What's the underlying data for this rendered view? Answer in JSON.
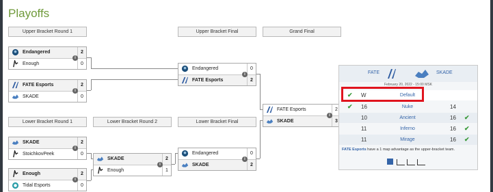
{
  "page_title": "Playoffs",
  "headers": {
    "ubr1": "Upper Bracket Round 1",
    "ubf": "Upper Bracket Final",
    "gf": "Grand Final",
    "lbr1": "Lower Bracket Round 1",
    "lbr2": "Lower Bracket Round 2",
    "lbf": "Lower Bracket Final"
  },
  "matches": {
    "ub1": {
      "t1": "Endangered",
      "s1": "2",
      "t2": "Enough",
      "s2": "0"
    },
    "ub2": {
      "t1": "FATE Esports",
      "s1": "2",
      "t2": "SKADE",
      "s2": "0"
    },
    "ubf": {
      "t1": "Endangered",
      "s1": "0",
      "t2": "FATE Esports",
      "s2": "2"
    },
    "gf": {
      "t1": "FATE Esports",
      "s1": "2",
      "t2": "SKADE",
      "s2": "3"
    },
    "lb1": {
      "t1": "SKADE",
      "s1": "2",
      "t2": "StoichkovPeek",
      "s2": "0"
    },
    "lb2": {
      "t1": "Enough",
      "s1": "2",
      "t2": "Tidal Esports",
      "s2": "0"
    },
    "lbr2": {
      "t1": "SKADE",
      "s1": "2",
      "t2": "Enough",
      "s2": "1"
    },
    "lbf": {
      "t1": "Endangered",
      "s1": "0",
      "t2": "SKADE",
      "s2": "2"
    }
  },
  "info_icon": "i",
  "detail": {
    "team1": "FATE",
    "team2": "SKADE",
    "date": "February 20, 2022 - 15:00 MSK",
    "maps": [
      {
        "left": "W",
        "name": "Default",
        "right": ""
      },
      {
        "left": "16",
        "name": "Nuke",
        "right": "14"
      },
      {
        "left": "10",
        "name": "Ancient",
        "right": "16"
      },
      {
        "left": "11",
        "name": "Inferno",
        "right": "16"
      },
      {
        "left": "11",
        "name": "Mirage",
        "right": "16"
      }
    ],
    "note_team": "FATE Esports",
    "note_text": " have a 1 map advantage as the upper-bracket team."
  },
  "colors": {
    "title": "#6f9a3a",
    "win": "#3a9a3a",
    "highlight": "#e0141e",
    "link": "#3464a8"
  }
}
